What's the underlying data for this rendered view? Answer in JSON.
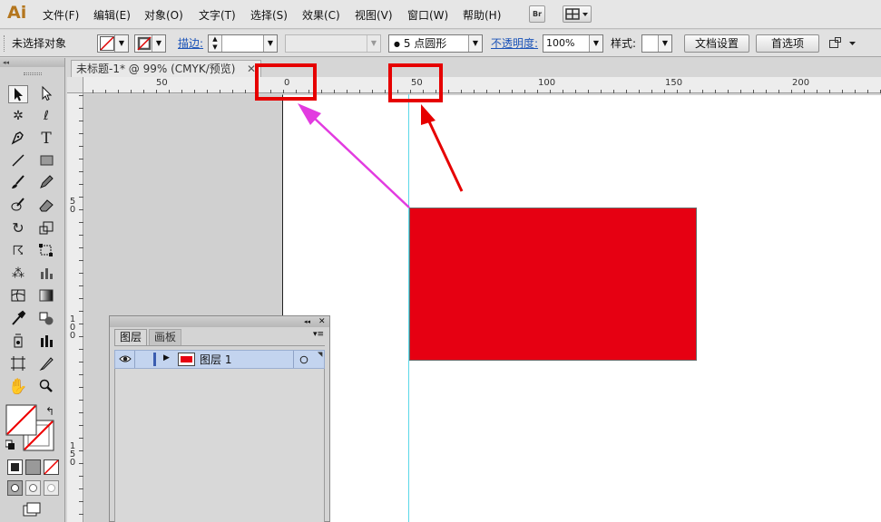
{
  "app": {
    "logo": "Ai"
  },
  "menubar": {
    "items": [
      "文件(F)",
      "编辑(E)",
      "对象(O)",
      "文字(T)",
      "选择(S)",
      "效果(C)",
      "视图(V)",
      "窗口(W)",
      "帮助(H)"
    ],
    "bridge_label": "Br"
  },
  "control_bar": {
    "selection_status": "未选择对象",
    "stroke_label": "描边:",
    "brush_value": "5 点圆形",
    "opacity_label": "不透明度:",
    "opacity_value": "100%",
    "style_label": "样式:",
    "doc_setup_button": "文档设置",
    "preferences_button": "首选项"
  },
  "document": {
    "tab_title": "未标题-1* @ 99% (CMYK/预览)",
    "ruler_h": [
      "50",
      "0",
      "50",
      "100",
      "150",
      "200"
    ],
    "ruler_v_labels": [
      "5\n0",
      "1\n0\n0",
      "1\n5\n0"
    ]
  },
  "layers_panel": {
    "tabs": [
      "图层",
      "画板"
    ],
    "layer_name": "图层 1"
  },
  "colors": {
    "rectangle_fill": "#e60012",
    "annotation_red": "#e60000",
    "annotation_magenta": "#e23be0",
    "guide": "#5ad8e8",
    "logo": "#b4761e"
  },
  "icons": {
    "tools": [
      "selection-tool-icon",
      "direct-selection-tool-icon",
      "magic-wand-tool-icon",
      "lasso-tool-icon",
      "pen-tool-icon",
      "type-tool-icon",
      "line-tool-icon",
      "rectangle-tool-icon",
      "paintbrush-tool-icon",
      "pencil-tool-icon",
      "blob-brush-tool-icon",
      "eraser-tool-icon",
      "rotate-tool-icon",
      "scale-tool-icon",
      "warp-tool-icon",
      "free-transform-tool-icon",
      "symbol-sprayer-tool-icon",
      "graph-tool-icon",
      "mesh-tool-icon",
      "gradient-tool-icon",
      "eyedropper-tool-icon",
      "blend-tool-icon",
      "column-graph-tool-icon",
      "artboard-tool-icon",
      "slice-tool-icon",
      "hand-tool-icon",
      "zoom-tool-icon"
    ]
  }
}
